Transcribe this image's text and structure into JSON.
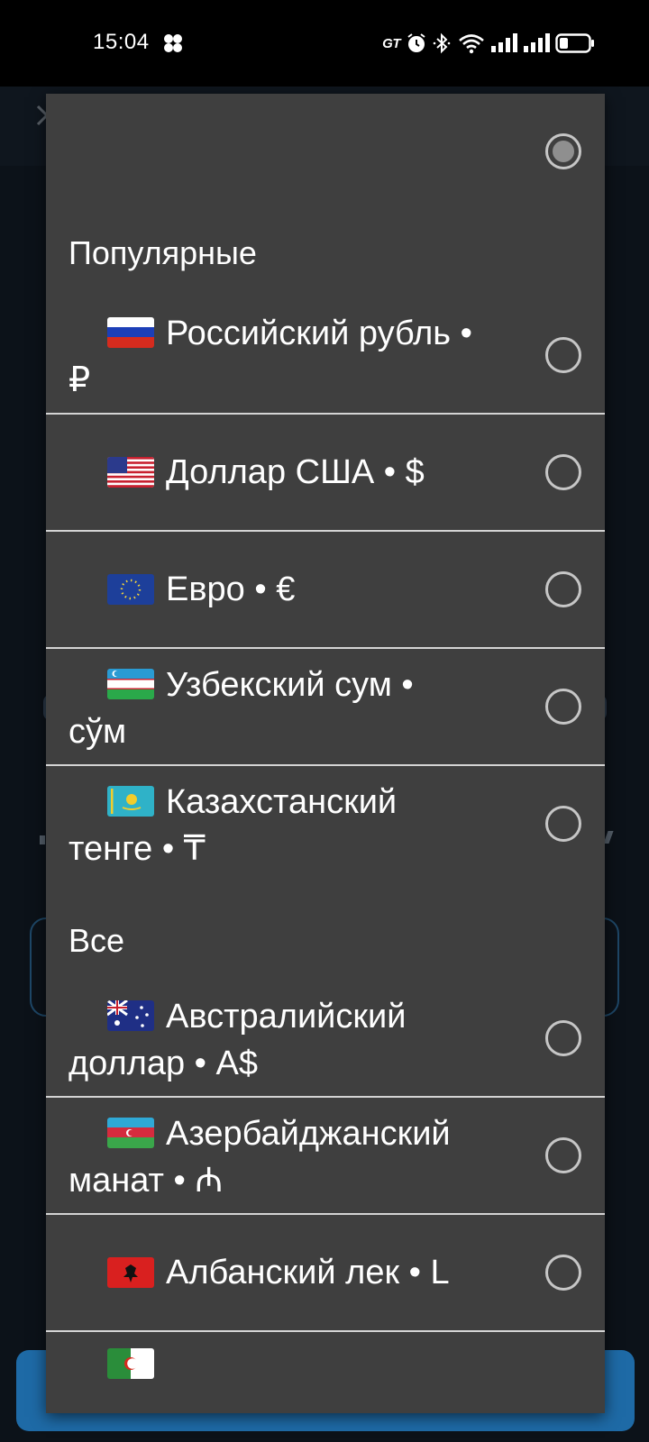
{
  "status_bar": {
    "time": "15:04",
    "badge": "GT"
  },
  "icons": {
    "status_left": "weather-dots-icon",
    "alarm": "alarm-icon",
    "bluetooth": "bluetooth-icon",
    "wifi": "wifi-icon",
    "signal_1": "signal-icon",
    "signal_2": "signal-icon",
    "battery": "battery-icon",
    "close": "close-icon",
    "menu": "more-vertical-icon"
  },
  "colors": {
    "dialog_background": "#3f3f3f",
    "divider": "#d4d4d4",
    "radio": "#c6c6c6",
    "primary_button": "#1e6aa6"
  },
  "dialog": {
    "top_option_selected": true,
    "sections": [
      {
        "title": "Популярные",
        "items": [
          {
            "flag": "russia-flag-icon",
            "line1": "Российский рубль •",
            "line2": "₽",
            "selected": false
          },
          {
            "flag": "usa-flag-icon",
            "line1": "Доллар США • $",
            "line2": "",
            "selected": false
          },
          {
            "flag": "eu-flag-icon",
            "line1": "Евро • €",
            "line2": "",
            "selected": false
          },
          {
            "flag": "uzbekistan-flag-icon",
            "line1": "Узбекский сум •",
            "line2": "сўм",
            "selected": false
          },
          {
            "flag": "kazakhstan-flag-icon",
            "line1": "Казахстанский",
            "line2": "тенге • ₸",
            "selected": false
          }
        ]
      },
      {
        "title": "Все",
        "items": [
          {
            "flag": "australia-flag-icon",
            "line1": "Австралийский",
            "line2": "доллар • A$",
            "selected": false
          },
          {
            "flag": "azerbaijan-flag-icon",
            "line1": "Азербайджанский",
            "line2": "манат • ₼",
            "selected": false
          },
          {
            "flag": "albania-flag-icon",
            "line1": "Албанский лек • L",
            "line2": "",
            "selected": false
          },
          {
            "flag": "algeria-flag-icon",
            "line1": "",
            "line2": "",
            "selected": false
          }
        ]
      }
    ]
  }
}
